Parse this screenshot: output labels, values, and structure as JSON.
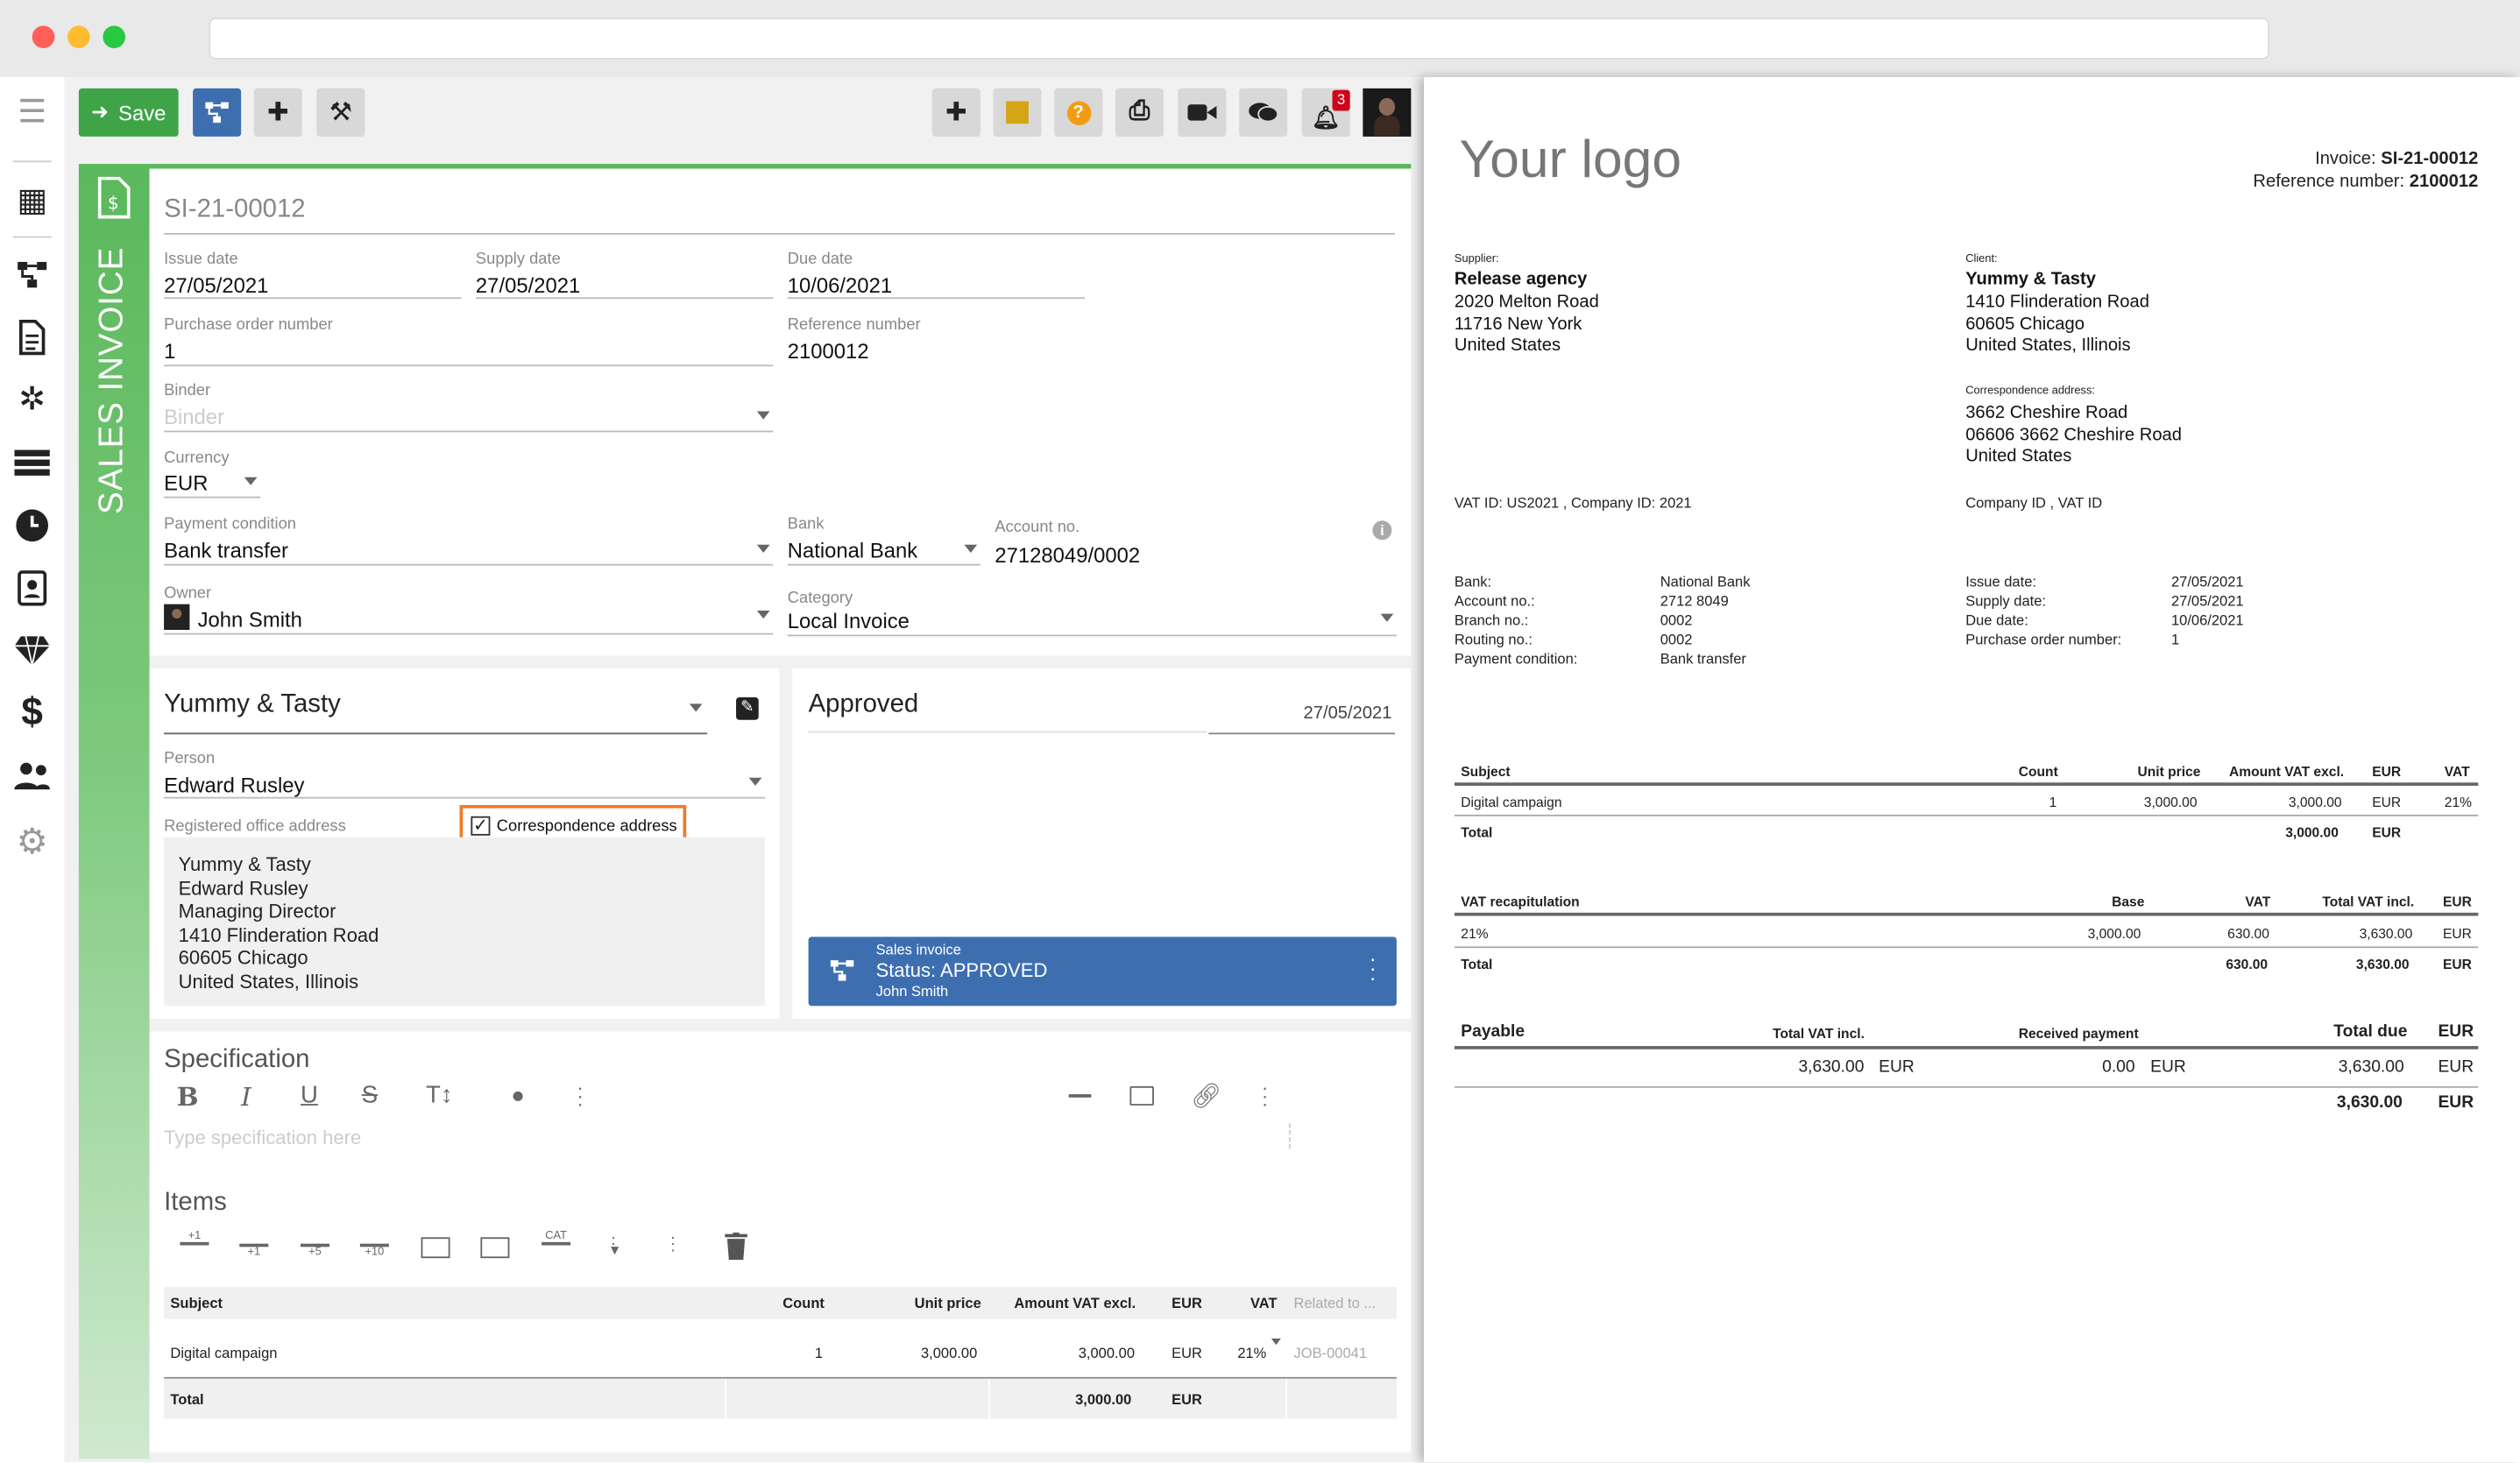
{
  "toolbar": {
    "save_label": "Save",
    "notification_count": "3"
  },
  "form": {
    "vertical_title": "SALES INVOICE",
    "document_number": "SI-21-00012",
    "issue_date": {
      "label": "Issue date",
      "value": "27/05/2021"
    },
    "supply_date": {
      "label": "Supply date",
      "value": "27/05/2021"
    },
    "due_date": {
      "label": "Due date",
      "value": "10/06/2021"
    },
    "purchase_order": {
      "label": "Purchase order number",
      "value": "1"
    },
    "reference_number": {
      "label": "Reference number",
      "value": "2100012"
    },
    "binder": {
      "label": "Binder",
      "placeholder": "Binder"
    },
    "currency": {
      "label": "Currency",
      "value": "EUR"
    },
    "payment_condition": {
      "label": "Payment condition",
      "value": "Bank transfer"
    },
    "bank": {
      "label": "Bank",
      "value": "National Bank"
    },
    "account_no": {
      "label": "Account no.",
      "value": "27128049/0002"
    },
    "owner": {
      "label": "Owner",
      "value": "John Smith"
    },
    "category": {
      "label": "Category",
      "value": "Local Invoice"
    }
  },
  "client": {
    "name": "Yummy & Tasty",
    "person_label": "Person",
    "person": "Edward Rusley",
    "address_label": "Registered office address",
    "correspondence_label": "Correspondence address",
    "address_lines": [
      "Yummy & Tasty",
      "Edward Rusley",
      "Managing Director",
      "1410 Flinderation Road",
      "60605 Chicago",
      "United States, Illinois"
    ]
  },
  "status_panel": {
    "title": "Approved",
    "date": "27/05/2021",
    "card_type": "Sales invoice",
    "card_status": "Status: APPROVED",
    "card_user": "John Smith"
  },
  "specification": {
    "title": "Specification",
    "placeholder": "Type specification here"
  },
  "items": {
    "title": "Items",
    "tool_labels": {
      "add_above": "+1",
      "add_below": "+1",
      "add5": "+5",
      "add10": "+10",
      "cat": "CAT"
    },
    "headers": {
      "subject": "Subject",
      "count": "Count",
      "unit_price": "Unit price",
      "amount": "Amount VAT excl.",
      "currency": "EUR",
      "vat": "VAT",
      "related": "Related to ..."
    },
    "row": {
      "subject": "Digital campaign",
      "count": "1",
      "unit_price": "3,000.00",
      "amount": "3,000.00",
      "currency": "EUR",
      "vat": "21%",
      "related": "JOB-00041"
    },
    "total": {
      "label": "Total",
      "amount": "3,000.00",
      "currency": "EUR"
    }
  },
  "invoice": {
    "logo": "Your logo",
    "invoice_label": "Invoice:",
    "invoice_number": "SI-21-00012",
    "ref_label": "Reference number:",
    "ref_number": "2100012",
    "supplier_label": "Supplier:",
    "supplier_name": "Release agency",
    "supplier_lines": [
      "2020 Melton Road",
      "11716 New York",
      "United States"
    ],
    "client_label": "Client:",
    "client_name": "Yummy & Tasty",
    "client_lines": [
      "1410 Flinderation Road",
      "60605 Chicago",
      "United States, Illinois"
    ],
    "corr_label": "Correspondence address:",
    "corr_lines": [
      "3662 Cheshire Road",
      "06606 3662 Cheshire Road",
      "United States"
    ],
    "vat_supplier": "VAT ID: US2021 , Company ID: 2021",
    "vat_client": "Company ID  , VAT ID",
    "bank_labels": [
      "Bank:",
      "Account no.:",
      "Branch no.:",
      "Routing no.:",
      "Payment condition:"
    ],
    "bank_values": [
      "National Bank",
      "2712 8049",
      "0002",
      "0002",
      "Bank transfer"
    ],
    "date_labels": [
      "Issue date:",
      "Supply date:",
      "Due date:",
      "Purchase order number:"
    ],
    "date_values": [
      "27/05/2021",
      "27/05/2021",
      "10/06/2021",
      "1"
    ],
    "items_headers": {
      "subject": "Subject",
      "count": "Count",
      "unit": "Unit price",
      "amount": "Amount VAT excl.",
      "cur": "EUR",
      "vat": "VAT"
    },
    "items_row": {
      "subject": "Digital campaign",
      "count": "1",
      "unit": "3,000.00",
      "amount": "3,000.00",
      "cur": "EUR",
      "vat": "21%"
    },
    "items_total": {
      "label": "Total",
      "amount": "3,000.00",
      "cur": "EUR"
    },
    "vat_headers": {
      "title": "VAT recapitulation",
      "base": "Base",
      "vat": "VAT",
      "total": "Total VAT incl.",
      "cur": "EUR"
    },
    "vat_row": {
      "rate": "21%",
      "base": "3,000.00",
      "vat": "630.00",
      "total": "3,630.00",
      "cur": "EUR"
    },
    "vat_total": {
      "label": "Total",
      "vat": "630.00",
      "total": "3,630.00",
      "cur": "EUR"
    },
    "payable": {
      "label": "Payable",
      "total_vat_label": "Total VAT incl.",
      "received_label": "Received payment",
      "due_label": "Total due",
      "cur_label": "EUR",
      "total_vat": "3,630.00",
      "total_vat_cur": "EUR",
      "received": "0.00",
      "received_cur": "EUR",
      "due": "3,630.00",
      "due_cur": "EUR",
      "grand": "3,630.00",
      "grand_cur": "EUR"
    }
  }
}
